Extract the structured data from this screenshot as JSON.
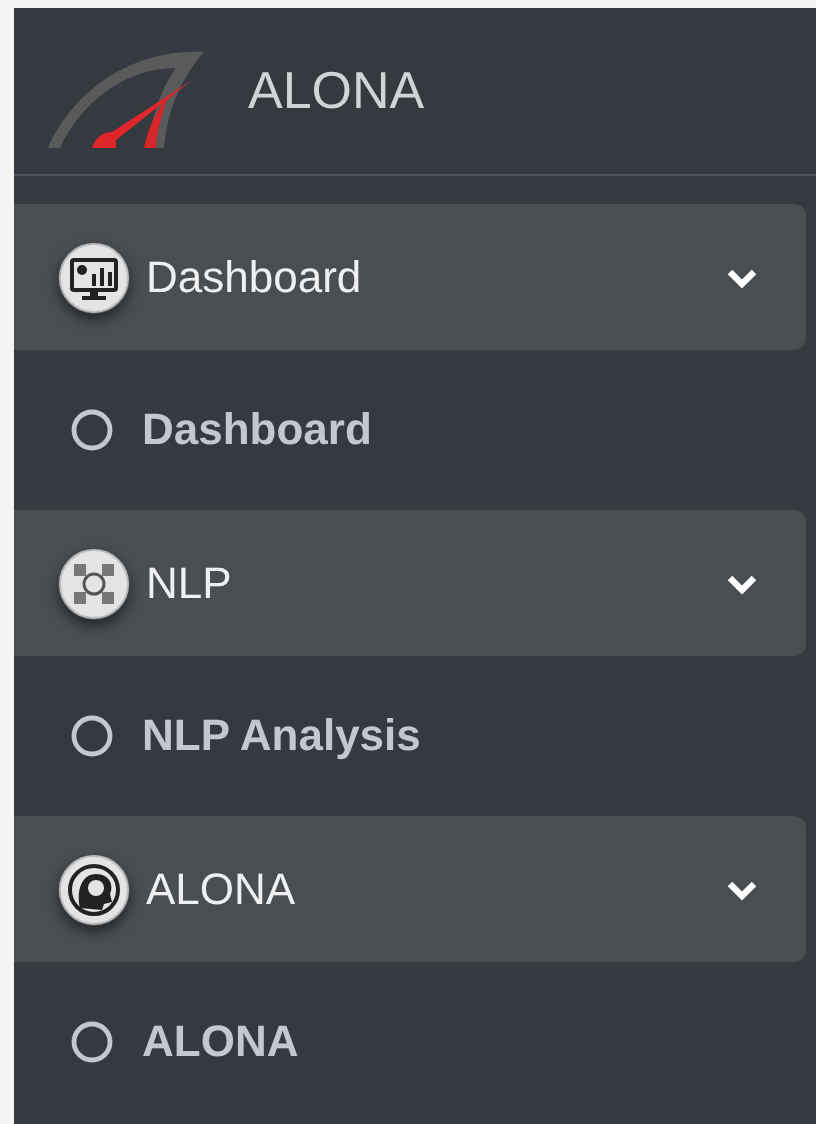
{
  "brand": {
    "name": "ALONA"
  },
  "menu": [
    {
      "label": "Dashboard",
      "expanded": true,
      "children": [
        {
          "label": "Dashboard"
        }
      ]
    },
    {
      "label": "NLP",
      "expanded": true,
      "children": [
        {
          "label": "NLP Analysis"
        }
      ]
    },
    {
      "label": "ALONA",
      "expanded": true,
      "children": [
        {
          "label": "ALONA"
        }
      ]
    }
  ]
}
